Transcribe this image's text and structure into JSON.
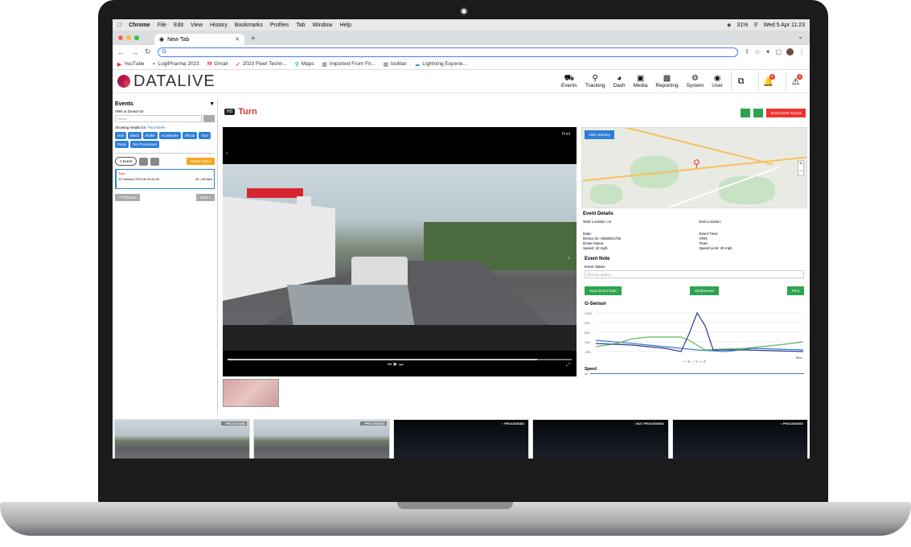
{
  "macbar": {
    "app": "Chrome",
    "menus": [
      "File",
      "Edit",
      "View",
      "History",
      "Bookmarks",
      "Profiles",
      "Tab",
      "Window",
      "Help"
    ],
    "battery": "31%",
    "datetime": "Wed 5 Apr  11:23"
  },
  "browser": {
    "tab_title": "New Tab",
    "url_value": "",
    "bookmarks": [
      "YouTube",
      "LogiPharma 2023",
      "Gmail",
      "2023 Fleet Techn...",
      "Maps",
      "Imported From Fir...",
      "toolbar",
      "Lightning Experie..."
    ]
  },
  "app": {
    "logo": "DATALIVE",
    "nav": [
      {
        "label": "Events",
        "icon": "car-icon"
      },
      {
        "label": "Tracking",
        "icon": "pin-icon"
      },
      {
        "label": "Dash",
        "icon": "gauge-icon"
      },
      {
        "label": "Media",
        "icon": "camera-icon"
      },
      {
        "label": "Reporting",
        "icon": "chart-icon"
      },
      {
        "label": "System",
        "icon": "gear-icon"
      },
      {
        "label": "User",
        "icon": "user-icon"
      }
    ],
    "notif_count": "0",
    "alert_count": "0"
  },
  "sidebar": {
    "title": "Events",
    "vrn_label": "VRN or Device ID",
    "select_placeholder": "Select...",
    "showing_prefix": "Showing results for:",
    "showing_period": "Past Week",
    "chips": [
      "Hail",
      "Block",
      "Brake",
      "Accelerate",
      "Shock",
      "Turn",
      "Panic",
      "Not Processed"
    ],
    "events_count": "1 Event",
    "reset_label": "Reset Filters",
    "event": {
      "title": "Turn",
      "date": "12 January 2023 at 00:44:28",
      "speed": "32 | 40 Mph"
    },
    "prev_label": "< Previous",
    "next_label": "Next >"
  },
  "main": {
    "hd_label": "HD",
    "event_title": "Turn",
    "send_label": "Send Event Access",
    "view_journey": "View Journey",
    "video_top_right": "Print"
  },
  "details": {
    "title": "Event Details",
    "start_location": "Start Location: on",
    "end_location": "End Location:",
    "date": "Date:",
    "event_time": "Event Time:",
    "device_id": "Device ID: 0000001706",
    "vrn": "VRN:",
    "driver": "Driver Name:",
    "fleet": "Fleet:",
    "speed": "Speed: 32 mph",
    "speed_limit": "Speed Limit: 40 mph"
  },
  "note": {
    "title": "Event Note",
    "status_label": "Event Status",
    "status_placeholder": "Choose option...",
    "save_label": "Save Event Note",
    "unobserved_label": "Unobserved",
    "print_label": "Print"
  },
  "gsensor": {
    "title": "G-Sensor",
    "y_ticks": [
      "1200",
      "900",
      "600",
      "250",
      "-250"
    ],
    "x_label": "Time",
    "legend": "— X  — Y  — Z",
    "colors": {
      "x": "#3a7bd5",
      "y": "#5cb85c",
      "z": "#2c3e8f"
    }
  },
  "speed": {
    "title": "Speed",
    "tick": "40"
  },
  "strip": [
    {
      "status": "PROCESSED",
      "type": "day"
    },
    {
      "status": "PROCESSED",
      "type": "day"
    },
    {
      "status": "PROCESSED",
      "type": "night"
    },
    {
      "status": "NOT PROCESSED",
      "type": "night"
    },
    {
      "status": "PROCESSED",
      "type": "night"
    }
  ]
}
